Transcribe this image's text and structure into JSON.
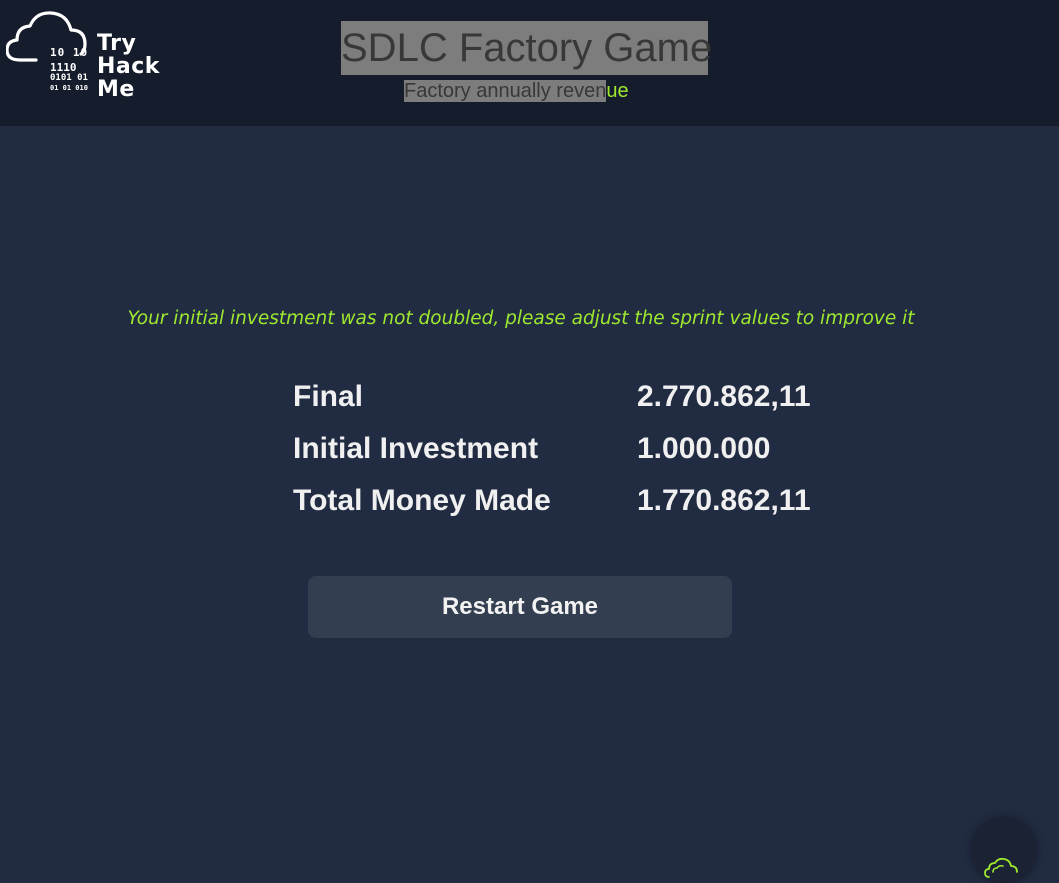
{
  "header": {
    "logo": {
      "bits_line1": "10 10",
      "bits_line2": "1110",
      "bits_line3": "0101 01",
      "bits_line4": "01 01 010",
      "text_line1": "Try",
      "text_line2": "Hack",
      "text_line3": "Me"
    },
    "title": "SDLC Factory Game",
    "subtitle_highlighted": "Factory annually reven",
    "subtitle_tail": "ue"
  },
  "main": {
    "message": "Your initial investment was not doubled, please adjust the sprint values to improve it",
    "results": [
      {
        "label": "Final",
        "value": "2.770.862,11"
      },
      {
        "label": "Initial Investment",
        "value": "1.000.000"
      },
      {
        "label": "Total Money Made",
        "value": "1.770.862,11"
      }
    ],
    "restart_label": "Restart Game"
  },
  "colors": {
    "page_bg": "#212c42",
    "header_bg": "#151c2b",
    "accent_green": "#9ee830",
    "button_bg": "#343e51",
    "selection_highlight": "#7d7d7d"
  },
  "icons": {
    "logo": "cloud-logo-icon",
    "floating_action": "cloud-chat-icon"
  }
}
